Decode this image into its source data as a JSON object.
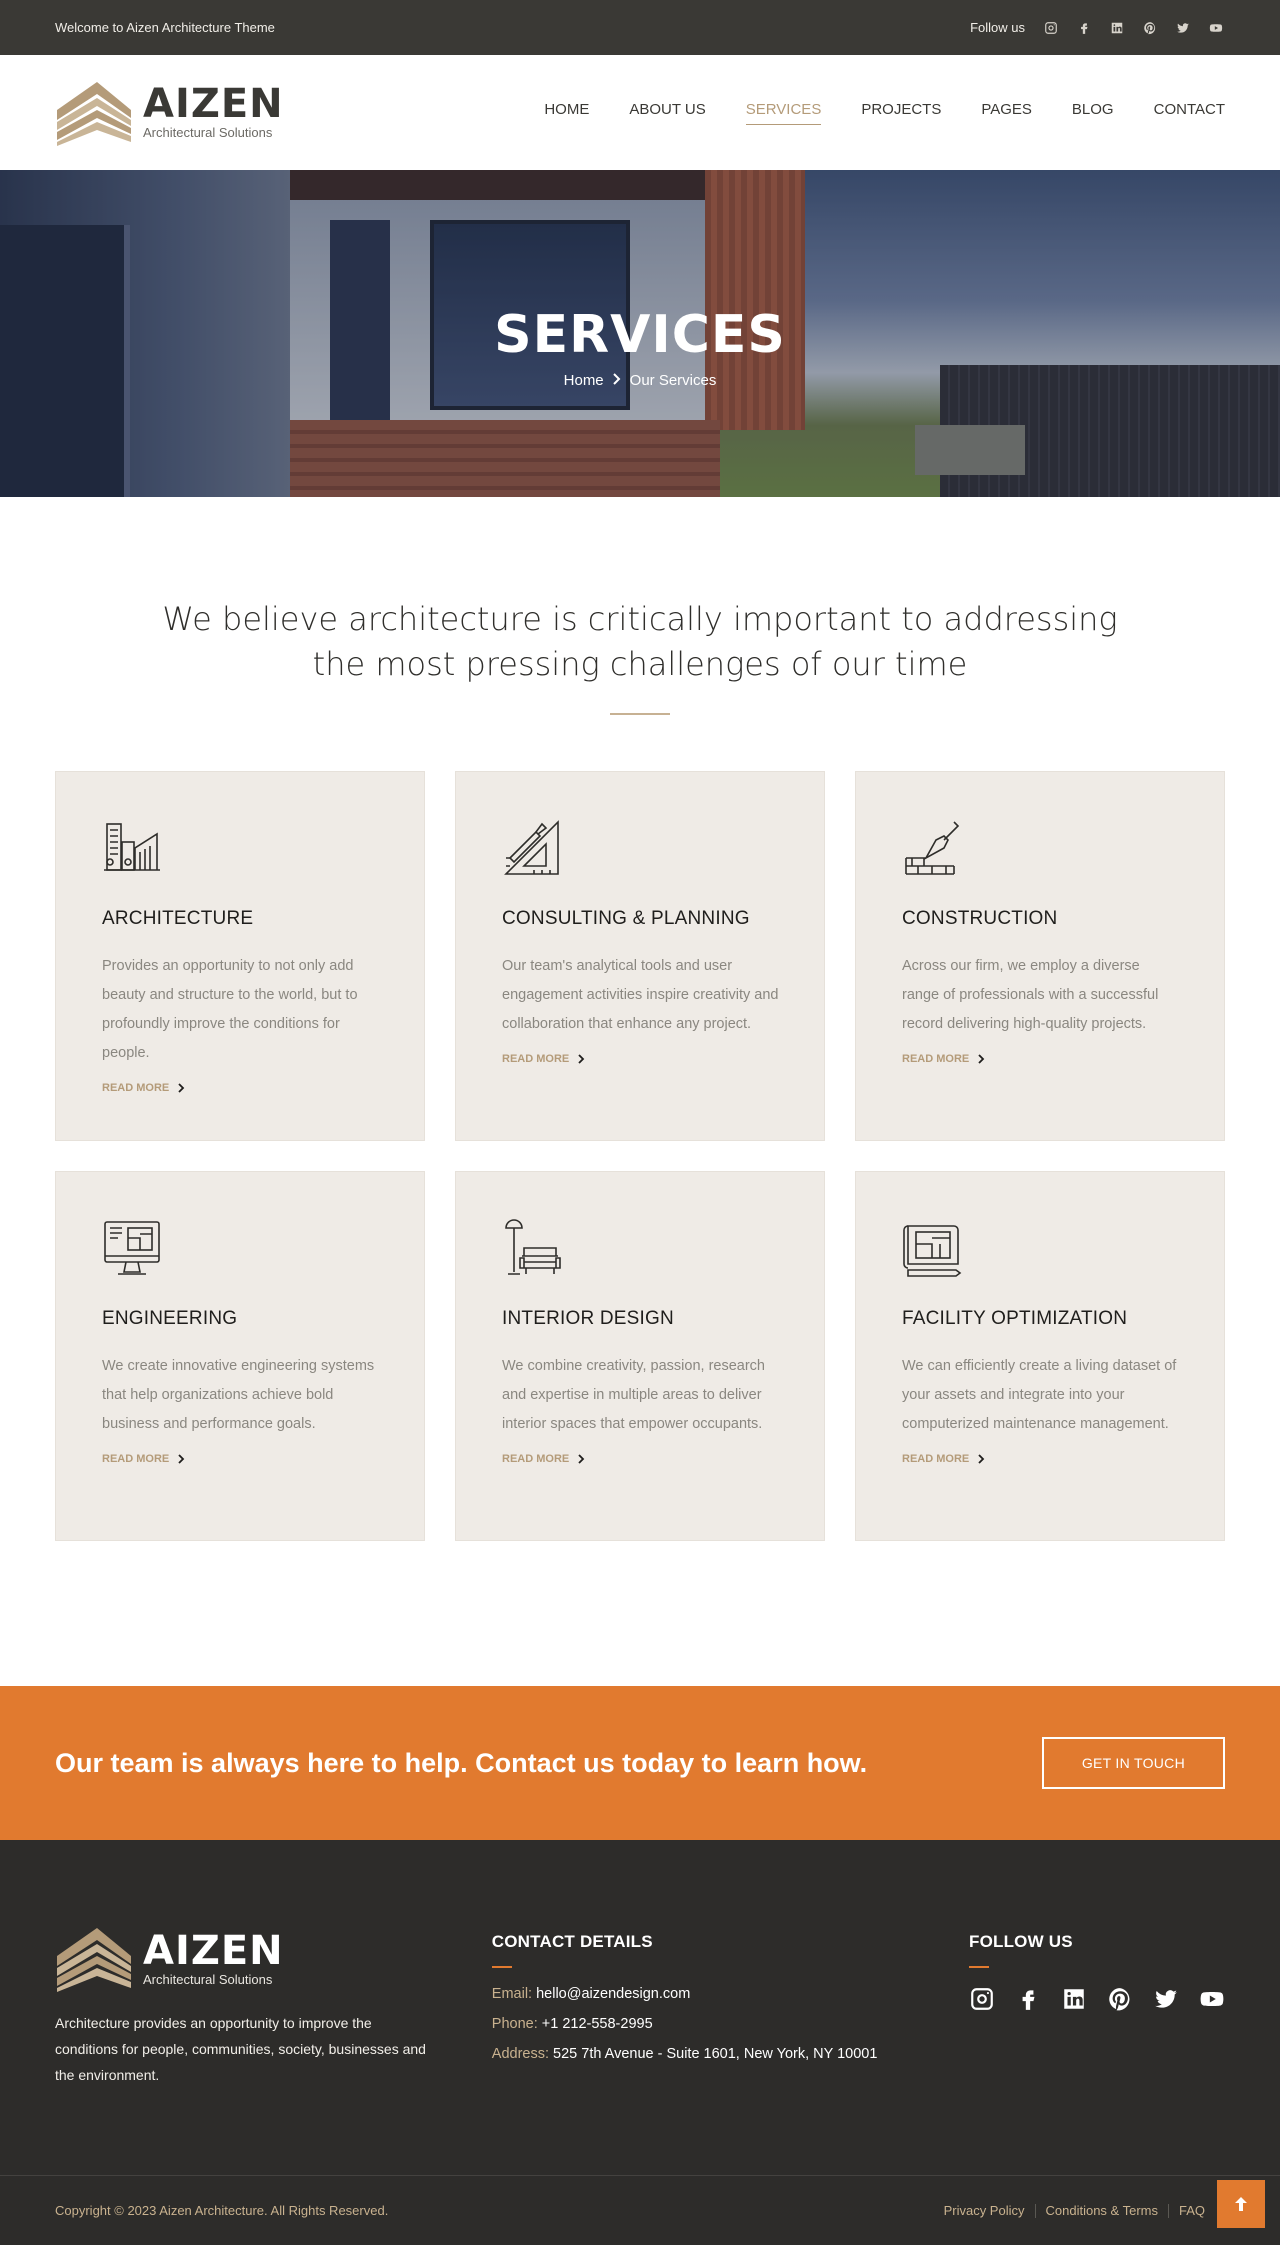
{
  "topbar": {
    "welcome": "Welcome to Aizen Architecture Theme",
    "follow_label": "Follow us"
  },
  "brand": {
    "name": "AIZEN",
    "tagline": "Architectural Solutions"
  },
  "nav": [
    {
      "label": "HOME"
    },
    {
      "label": "ABOUT US"
    },
    {
      "label": "SERVICES",
      "active": true
    },
    {
      "label": "PROJECTS"
    },
    {
      "label": "PAGES"
    },
    {
      "label": "BLOG"
    },
    {
      "label": "CONTACT"
    }
  ],
  "hero": {
    "title": "SERVICES",
    "crumb_home": "Home",
    "crumb_current": "Our Services"
  },
  "intro": {
    "line1": "We believe architecture is critically important to addressing",
    "line2": "the most pressing challenges of our time"
  },
  "services": [
    {
      "title": "ARCHITECTURE",
      "text": "Provides an opportunity to not only add beauty and structure to the world, but to profoundly improve the conditions for people.",
      "more": "READ MORE",
      "icon": "buildings-icon"
    },
    {
      "title": "CONSULTING & PLANNING",
      "text": "Our team's analytical tools and user engagement activities inspire creativity and collaboration that enhance any project.",
      "more": "READ MORE",
      "icon": "ruler-pencil-icon"
    },
    {
      "title": "CONSTRUCTION",
      "text": "Across our firm, we employ a diverse range of professionals with a successful record delivering high-quality projects.",
      "more": "READ MORE",
      "icon": "trowel-bricks-icon"
    },
    {
      "title": "ENGINEERING",
      "text": "We create innovative engineering systems that help organizations achieve bold business and performance goals.",
      "more": "READ MORE",
      "icon": "monitor-blueprint-icon"
    },
    {
      "title": "INTERIOR DESIGN",
      "text": "We combine creativity, passion, research and expertise in multiple areas to deliver interior spaces that empower occupants.",
      "more": "READ MORE",
      "icon": "sofa-lamp-icon"
    },
    {
      "title": "FACILITY OPTIMIZATION",
      "text": "We can efficiently create a living dataset of your assets and integrate into your computerized maintenance management.",
      "more": "READ MORE",
      "icon": "blueprint-scroll-icon"
    }
  ],
  "cta": {
    "text": "Our team is always here to help. Contact us today to learn how.",
    "button": "GET IN TOUCH"
  },
  "footer": {
    "about": "Architecture provides an opportunity to improve the conditions for people, communities, society, businesses and the environment.",
    "contact_title": "CONTACT DETAILS",
    "email_label": "Email:",
    "email": "hello@aizendesign.com",
    "phone_label": "Phone:",
    "phone": "+1 212-558-2995",
    "address_label": "Address:",
    "address": "525 7th Avenue - Suite 1601, New York, NY 10001",
    "follow_title": "FOLLOW US",
    "copyright": "Copyright © 2023 Aizen Architecture. All Rights Reserved.",
    "links": [
      "Privacy Policy",
      "Conditions & Terms",
      "FAQ"
    ]
  },
  "colors": {
    "accent": "#e17a2f",
    "gold": "#b49b79",
    "dark": "#3a3935",
    "card": "#efebe6"
  }
}
